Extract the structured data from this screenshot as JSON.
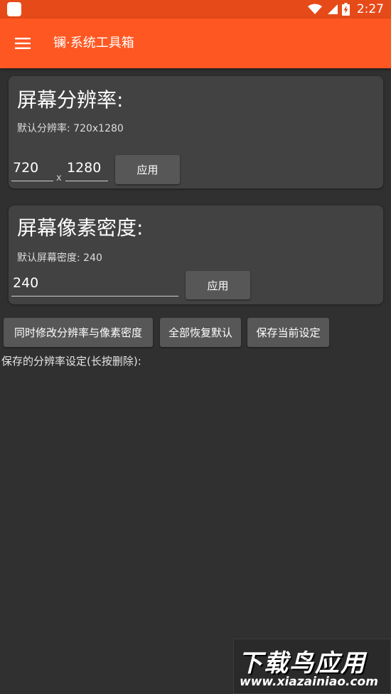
{
  "status_bar": {
    "time": "2:27",
    "icons": [
      "app-square-icon",
      "wifi-icon",
      "cell-signal-icon",
      "battery-charging-icon"
    ]
  },
  "app_bar": {
    "title": "镧·系统工具箱",
    "menu_icon": "hamburger-menu-icon"
  },
  "resolution_card": {
    "title": "屏幕分辨率:",
    "default_text": "默认分辨率: 720x1280",
    "width_value": "720",
    "separator": "x",
    "height_value": "1280",
    "apply_label": "应用"
  },
  "density_card": {
    "title": "屏幕像素密度:",
    "default_text": "默认屏幕密度: 240",
    "density_value": "240",
    "apply_label": "应用"
  },
  "actions": {
    "modify_both_label": "同时修改分辨率与像素密度",
    "restore_all_label": "全部恢复默认",
    "save_current_label": "保存当前设定"
  },
  "saved": {
    "label": "保存的分辨率设定(长按删除):"
  },
  "watermark": {
    "main": "下载鸟应用",
    "url": "www.xiazainiao.com"
  },
  "colors": {
    "status_bar": "#e64a19",
    "app_bar": "#ff5722",
    "background": "#303030",
    "card": "#424242",
    "button": "#575757"
  }
}
